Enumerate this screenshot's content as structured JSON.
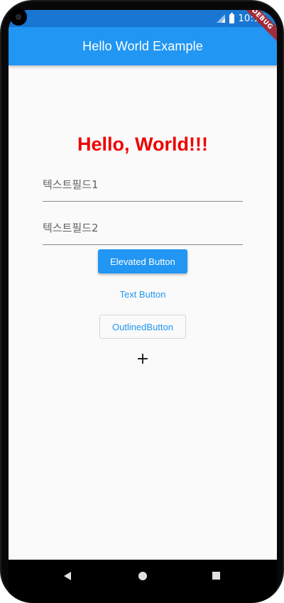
{
  "status_bar": {
    "time": "10:17",
    "debug_banner": "DEBUG",
    "signal_icon": "signal-icon",
    "battery_icon": "battery-icon"
  },
  "app_bar": {
    "title": "Hello World Example",
    "color": "#2196f3"
  },
  "main": {
    "hello_text": "Hello, World!!!",
    "hello_color": "#ee0000",
    "text_field_1": {
      "placeholder": "텍스트필드1",
      "value": ""
    },
    "text_field_2": {
      "placeholder": "텍스트필드2",
      "value": ""
    },
    "elevated_button_label": "Elevated Button",
    "text_button_label": "Text Button",
    "outlined_button_label": "OutlinedButton",
    "icon_button_icon": "add-icon",
    "icon_button_glyph": "+"
  },
  "nav_bar": {
    "back_icon": "back-icon",
    "home_icon": "home-icon",
    "recents_icon": "recents-icon"
  }
}
